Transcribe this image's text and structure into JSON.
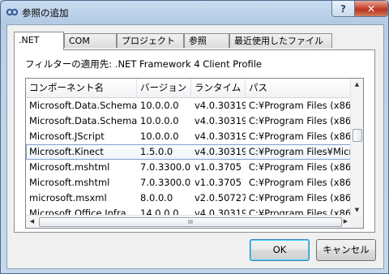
{
  "window": {
    "title": "参照の追加",
    "help_glyph": "?",
    "close_glyph": "✕"
  },
  "tabs": [
    {
      "label": ".NET",
      "active": true
    },
    {
      "label": "COM",
      "active": false
    },
    {
      "label": "プロジェクト",
      "active": false
    },
    {
      "label": "参照",
      "active": false
    },
    {
      "label": "最近使用したファイル",
      "active": false
    }
  ],
  "filter": {
    "label": "フィルターの適用先: .NET Framework 4 Client Profile"
  },
  "list": {
    "columns": [
      "コンポーネント名",
      "バージョン",
      "ランタイム",
      "パス"
    ],
    "rows": [
      [
        "Microsoft.Data.Schema...",
        "10.0.0.0",
        "v4.0.30319",
        "C:¥Program Files (x86..."
      ],
      [
        "Microsoft.Data.Schema...",
        "10.0.0.0",
        "v4.0.30319",
        "C:¥Program Files (x86..."
      ],
      [
        "Microsoft.JScript",
        "10.0.0.0",
        "v4.0.30319",
        "C:¥Program Files (x86..."
      ],
      [
        "Microsoft.Kinect",
        "1.5.0.0",
        "v4.0.30319",
        "C:¥Program Files¥Micr..."
      ],
      [
        "Microsoft.mshtml",
        "7.0.3300.0",
        "v1.0.3705",
        "C:¥Program Files (x86..."
      ],
      [
        "Microsoft.mshtml",
        "7.0.3300.0",
        "v1.0.3705",
        "C:¥Program Files (x86..."
      ],
      [
        "microsoft.msxml",
        "8.0.0.0",
        "v2.0.50727",
        "C:¥Program Files (x86..."
      ],
      [
        "Microsoft.Office.Infra...",
        "14.0.0.0",
        "v4.0.30319",
        "C:¥Program Files (x86..."
      ]
    ],
    "selected_index": 3,
    "scroll_up_glyph": "▲",
    "scroll_down_glyph": "▼",
    "scroll_left_glyph": "◀",
    "scroll_right_glyph": "▶",
    "grip_glyph": "III"
  },
  "buttons": {
    "ok": "OK",
    "cancel": "キャンセル"
  }
}
